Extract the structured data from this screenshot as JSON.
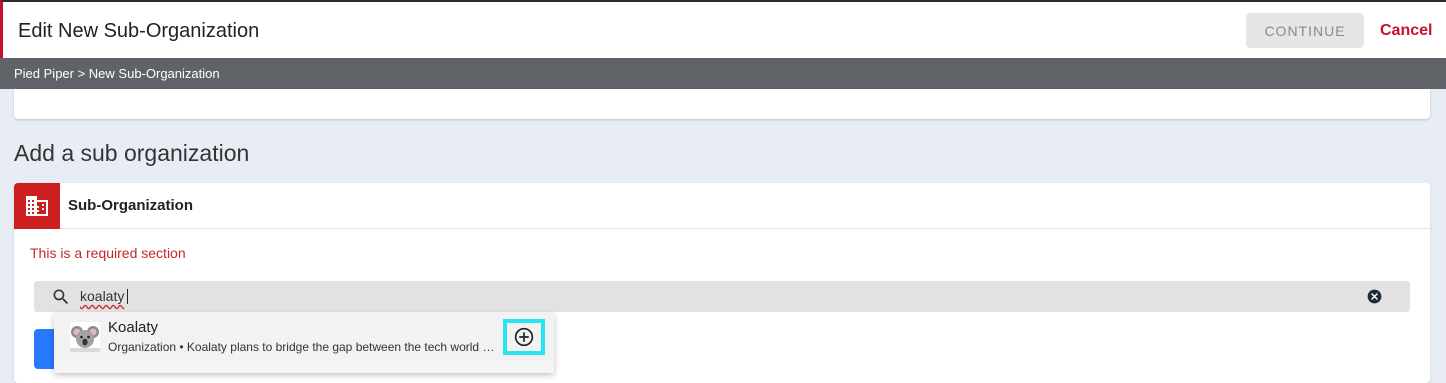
{
  "header": {
    "title": "Edit New Sub-Organization",
    "continue_label": "CONTINUE",
    "cancel_label": "Cancel"
  },
  "breadcrumb": {
    "text": "Pied Piper > New Sub-Organization"
  },
  "section": {
    "heading": "Add a sub organization"
  },
  "card": {
    "title": "Sub-Organization",
    "icon": "building-icon",
    "required_message": "This is a required section"
  },
  "search": {
    "value": "koalaty",
    "icon": "search-icon",
    "clear_icon": "clear-icon"
  },
  "results": [
    {
      "name": "Koalaty",
      "description": "Organization • Koalaty plans to bridge the gap between the tech world and the real world",
      "avatar": "koala-avatar",
      "action_icon": "add-circle-icon"
    }
  ],
  "colors": {
    "accent_red": "#cc1f1f",
    "breadcrumb_bg": "#5f6368",
    "highlight_cyan": "#27e6f2",
    "primary_blue": "#2979ff"
  }
}
